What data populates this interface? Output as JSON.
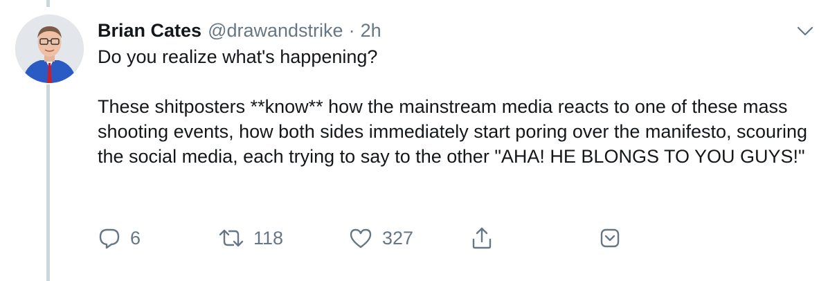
{
  "tweet": {
    "author": {
      "display_name": "Brian Cates",
      "handle": "@drawandstrike",
      "separator": "·",
      "time": "2h"
    },
    "body": {
      "line1": "Do you realize what's happening?",
      "paragraph2": "These shitposters **know** how the mainstream media reacts to one of these mass shooting events, how both sides immediately start poring over the manifesto, scouring the social media, each trying to say to the other \"AHA! HE BLONGS TO YOU GUYS!\""
    },
    "actions": {
      "reply_count": "6",
      "retweet_count": "118",
      "like_count": "327"
    },
    "icons": {
      "reply": "reply-icon",
      "retweet": "retweet-icon",
      "like": "heart-icon",
      "share": "share-icon",
      "more": "chevron-down-icon",
      "more_box": "dm-box-icon"
    },
    "colors": {
      "text": "#14171a",
      "secondary": "#657786",
      "thread_line": "#ccd6dd"
    }
  }
}
